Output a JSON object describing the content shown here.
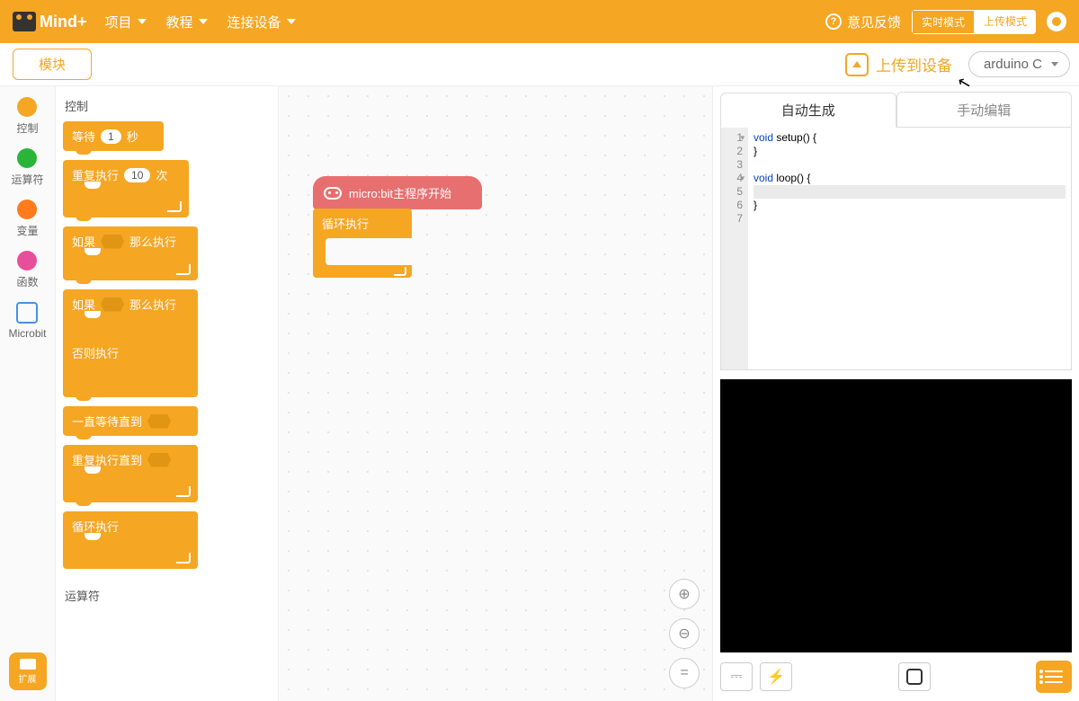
{
  "topbar": {
    "brand": "Mind+",
    "menus": [
      "项目",
      "教程",
      "连接设备"
    ],
    "feedback": "意见反馈",
    "mode_realtime": "实时模式",
    "mode_upload": "上传模式"
  },
  "secondrow": {
    "module_tab": "模块",
    "upload_label": "上传到设备",
    "language_selected": "arduino C"
  },
  "categories": [
    {
      "label": "控制",
      "color": "#f5a623"
    },
    {
      "label": "运算符",
      "color": "#2ab53a"
    },
    {
      "label": "变量",
      "color": "#ff7b1c"
    },
    {
      "label": "函数",
      "color": "#e84f9a"
    },
    {
      "label": "Microbit",
      "color": "#4a90e2",
      "chip": true
    }
  ],
  "extension_label": "扩展",
  "palette": {
    "section_control": "控制",
    "section_operators": "运算符",
    "block_wait_pre": "等待",
    "block_wait_val": "1",
    "block_wait_suf": "秒",
    "block_repeat_pre": "重复执行",
    "block_repeat_val": "10",
    "block_repeat_suf": "次",
    "block_if_pre": "如果",
    "block_if_suf": "那么执行",
    "block_else": "否则执行",
    "block_waituntil": "一直等待直到",
    "block_repeatuntil": "重复执行直到",
    "block_forever": "循环执行"
  },
  "canvas": {
    "hat_label": "micro:bit主程序开始",
    "loop_label": "循环执行"
  },
  "code_tabs": {
    "auto": "自动生成",
    "manual": "手动编辑"
  },
  "code": {
    "kw_void": "void",
    "setup_sig": " setup() {",
    "close_brace": "}",
    "loop_sig": " loop() {",
    "line_numbers": [
      "1",
      "2",
      "3",
      "4",
      "5",
      "6",
      "7"
    ]
  },
  "canvas_controls": {
    "zoom_in": "⊕",
    "zoom_out": "⊖",
    "center": "="
  }
}
